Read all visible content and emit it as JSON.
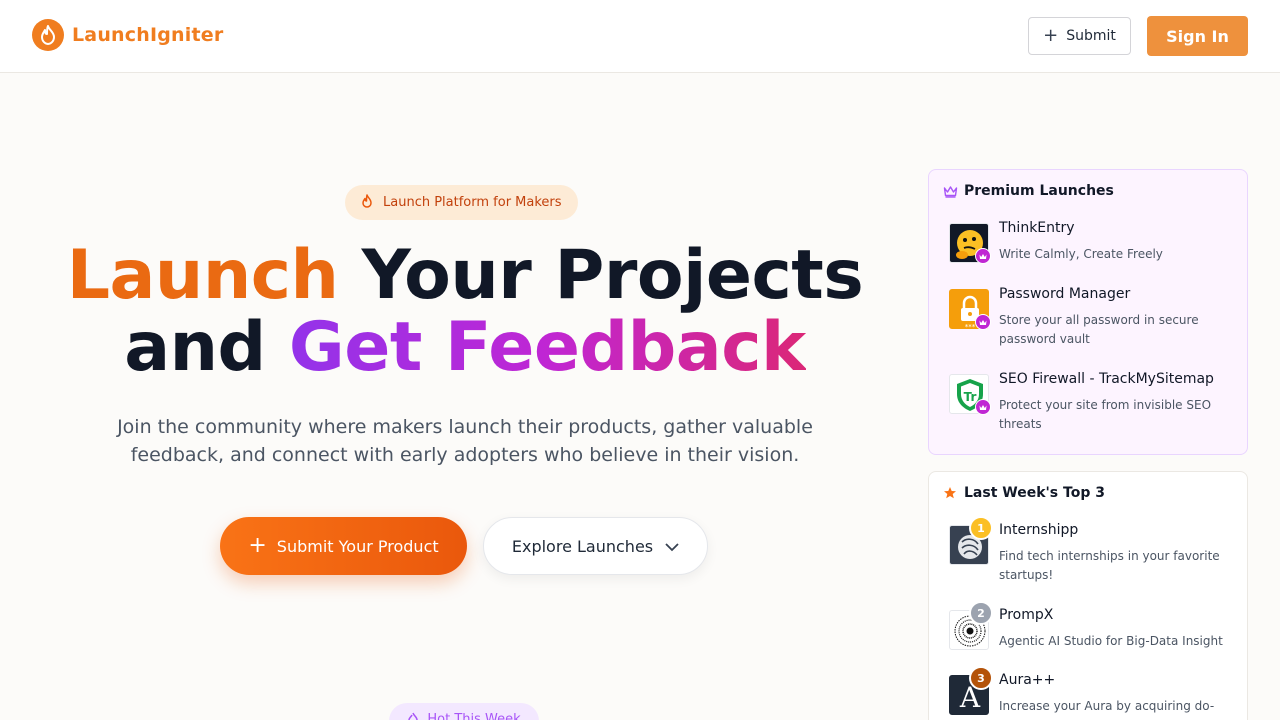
{
  "brand": {
    "name": "LaunchIgniter",
    "color": "#f07d1f",
    "icon": "flame-icon"
  },
  "header": {
    "submit_label": "Submit",
    "signin_label": "Sign In"
  },
  "hero": {
    "badge": "Launch Platform for Makers",
    "title_word1": "Launch",
    "title_rest1": " Your Projects",
    "title_and": "and ",
    "title_grad": "Get Feedback",
    "subtitle": "Join the community where makers launch their products, gather valuable feedback, and connect with early adopters who believe in their vision.",
    "cta_primary": "Submit Your Product",
    "cta_secondary": "Explore Launches",
    "hot_badge": "Hot This Week"
  },
  "premium": {
    "title": "Premium Launches",
    "items": [
      {
        "name": "ThinkEntry",
        "desc": "Write Calmly, Create Freely",
        "icon": "thinking-face-icon"
      },
      {
        "name": "Password Manager",
        "desc": "Store your all password in secure password vault",
        "icon": "lock-icon"
      },
      {
        "name": "SEO Firewall - TrackMySitemap",
        "desc": "Protect your site from invisible SEO threats",
        "icon": "shield-icon"
      }
    ]
  },
  "top3": {
    "title": "Last Week's Top 3",
    "items": [
      {
        "rank": "1",
        "name": "Internshipp",
        "desc": "Find tech internships in your favorite startups!",
        "rank_color": "#fbbf24"
      },
      {
        "rank": "2",
        "name": "PrompX",
        "desc": "Agentic AI Studio for Big-Data Insight",
        "rank_color": "#9ca3af"
      },
      {
        "rank": "3",
        "name": "Aura++",
        "desc": "Increase your Aura by acquiring do-",
        "rank_color": "#b45309"
      }
    ]
  }
}
